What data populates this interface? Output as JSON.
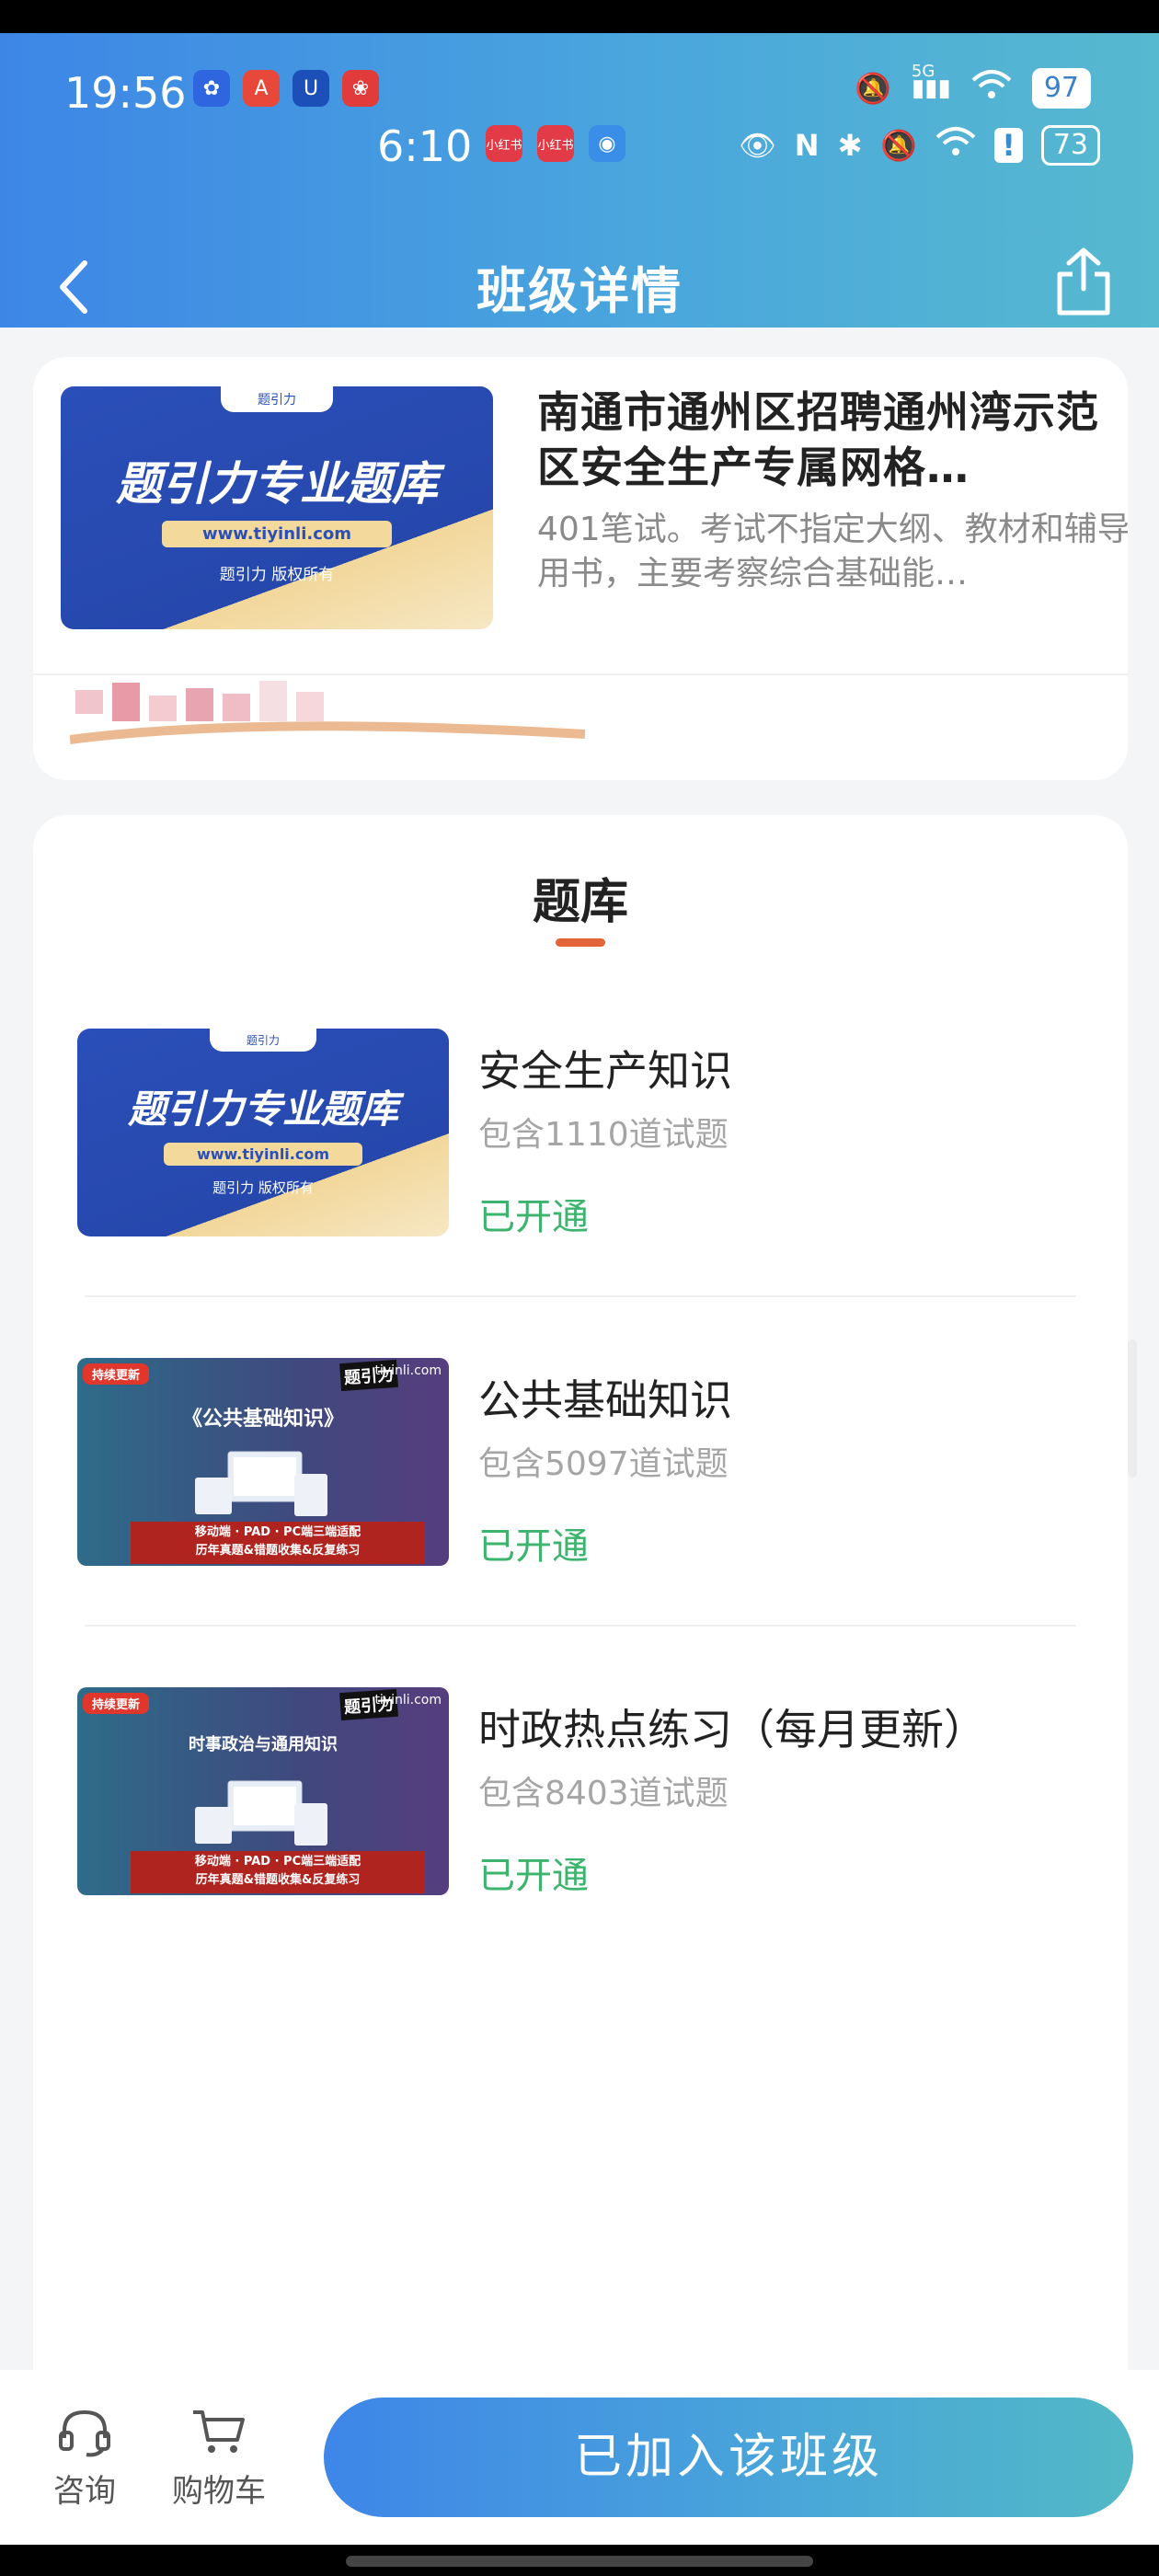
{
  "status_bar": {
    "time_primary": "19:56",
    "battery_primary": "97",
    "network_label": "5G",
    "time_secondary": "6:10",
    "battery_secondary": "73",
    "app_icons_primary": [
      "app-icon-blue",
      "app-icon-a",
      "app-icon-u",
      "app-icon-red"
    ],
    "app_icons_secondary": [
      "小红书",
      "小红书",
      "app-icon-globe"
    ]
  },
  "header": {
    "title": "班级详情",
    "back_icon": "chevron-left-icon",
    "share_icon": "share-icon"
  },
  "course": {
    "title": "南通市通州区招聘通州湾示范区安全生产专属网格…",
    "description": "401笔试。考试不指定大纲、教材和辅导用书，主要考察综合基础能…",
    "thumb": {
      "brand": "题引力",
      "headline": "题引力专业题库",
      "url": "www.tiyinli.com",
      "copyright": "题引力 版权所有"
    }
  },
  "bank": {
    "title": "题库",
    "items": [
      {
        "name": "安全生产知识",
        "count": "包含1110道试题",
        "status": "已开通",
        "thumb": {
          "brand": "题引力",
          "headline": "题引力专业题库",
          "url": "www.tiyinli.com",
          "copyright": "题引力 版权所有"
        }
      },
      {
        "name": "公共基础知识",
        "count": "包含5097道试题",
        "status": "已开通",
        "thumb": {
          "tag": "持续更新",
          "logo": "题引力",
          "site": "tiyinli.com",
          "title": "《公共基础知识》",
          "banner_line1": "移动端 · PAD · PC端三端适配",
          "banner_line2": "历年真题&错题收集&反复练习"
        }
      },
      {
        "name": "时政热点练习（每月更新）",
        "count": "包含8403道试题",
        "status": "已开通",
        "thumb": {
          "tag": "持续更新",
          "logo": "题引力",
          "site": "tiyinli.com",
          "title": "时事政治与通用知识",
          "banner_line1": "移动端 · PAD · PC端三端适配",
          "banner_line2": "历年真题&错题收集&反复练习"
        }
      }
    ]
  },
  "bottom": {
    "consult_label": "咨询",
    "cart_label": "购物车",
    "join_label": "已加入该班级",
    "consult_icon": "headset-icon",
    "cart_icon": "cart-icon"
  },
  "colors": {
    "header_start": "#3d86e6",
    "header_end": "#57b9cf",
    "status_open": "#3cb46e",
    "tab_underline": "#e4643a"
  }
}
